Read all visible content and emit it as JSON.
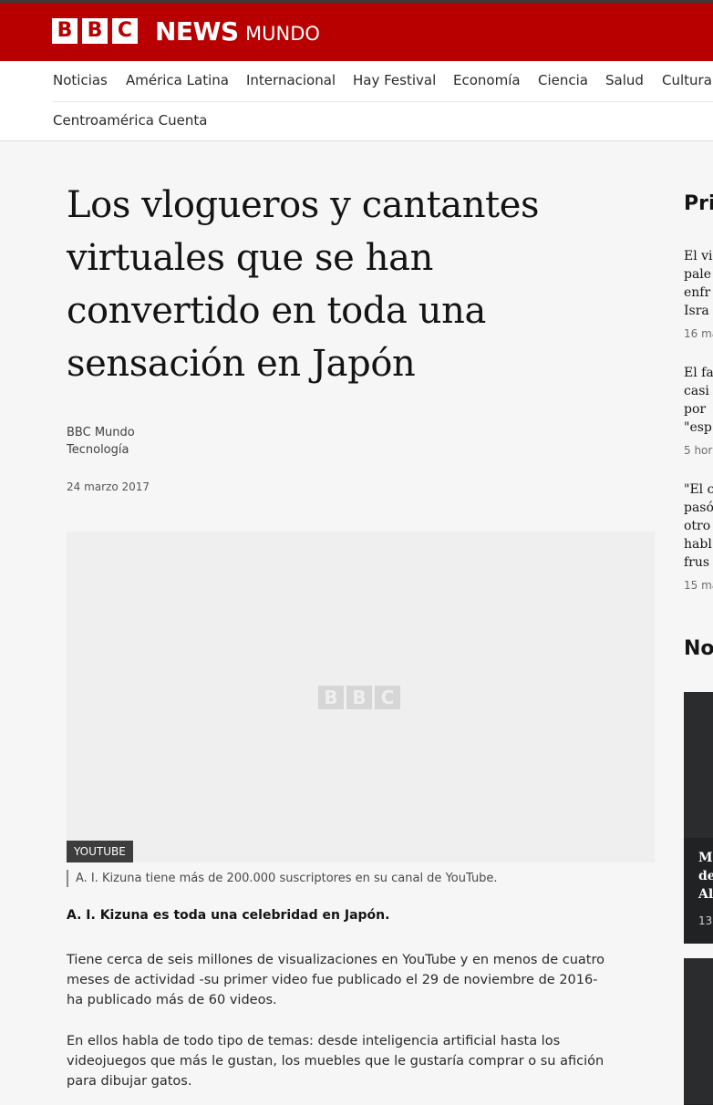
{
  "brand": {
    "letters": [
      "B",
      "B",
      "C"
    ],
    "news": "NEWS",
    "edition": "MUNDO",
    "colors": {
      "masthead": "#b80000",
      "text_white": "#ffffff"
    }
  },
  "nav": {
    "items": [
      "Noticias",
      "América Latina",
      "Internacional",
      "Hay Festival",
      "Economía",
      "Ciencia",
      "Salud",
      "Cultura"
    ],
    "second_row": [
      "Centroamérica Cuenta"
    ]
  },
  "article": {
    "headline_lines": [
      "Los vlogueros y cantantes",
      "virtuales que se han",
      "convertido en toda una",
      "sensación en Japón"
    ],
    "byline_source": "BBC Mundo",
    "byline_topic": "Tecnología",
    "date": "24 marzo 2017",
    "image": {
      "placeholder_letters": [
        "B",
        "B",
        "C"
      ],
      "credit": "YOUTUBE",
      "caption": "A. I. Kizuna tiene más de 200.000 suscriptores en su canal de YouTube."
    },
    "lead": "A. I. Kizuna es toda una celebridad en Japón.",
    "paragraphs": [
      {
        "lines": [
          "Tiene cerca de seis millones de visualizaciones en YouTube y en menos de cuatro",
          "meses de actividad -su primer video fue publicado el 29 de noviembre de 2016-",
          "ha publicado más de 60 videos."
        ]
      },
      {
        "lines": [
          "En ellos habla de todo tipo de temas: desde inteligencia artificial hasta los",
          "videojuegos que más le gustan, los muebles que le gustaría comprar o su afición",
          "para dibujar gatos."
        ]
      }
    ]
  },
  "sidebar": {
    "heading_1": "Pri",
    "items": [
      {
        "lines": [
          "El vi",
          "pale",
          "enfr",
          "Isra"
        ],
        "time": "16 ma"
      },
      {
        "lines": [
          "El fa",
          "casi",
          "por ",
          "\"esp"
        ],
        "time": "5 hor"
      },
      {
        "lines": [
          "\"El c",
          "pasó",
          "otro",
          "habl",
          "frus"
        ],
        "time": "15 ma"
      }
    ],
    "heading_2": "No",
    "card": {
      "lines": [
        "M",
        "de",
        "Al"
      ],
      "time": "13"
    }
  }
}
